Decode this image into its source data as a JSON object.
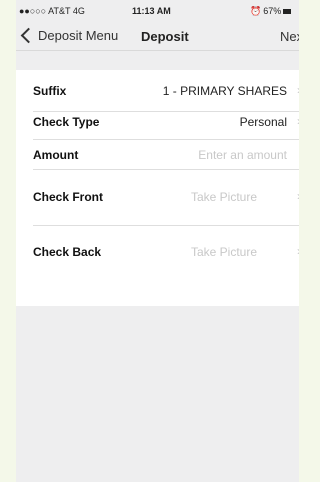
{
  "status_bar": {
    "carrier": "●●○○○ AT&T  4G",
    "time": "11:13 AM",
    "battery": "67%"
  },
  "nav": {
    "back_label": "Deposit Menu",
    "title": "Deposit",
    "next_label": "Next"
  },
  "form": {
    "suffix": {
      "label": "Suffix",
      "value": "1 - PRIMARY SHARES"
    },
    "check_type": {
      "label": "Check Type",
      "value": "Personal"
    },
    "amount": {
      "label": "Amount",
      "placeholder": "Enter an amount"
    },
    "check_front": {
      "label": "Check Front",
      "value": "Take Picture"
    },
    "check_back": {
      "label": "Check Back",
      "value": "Take Picture"
    }
  }
}
